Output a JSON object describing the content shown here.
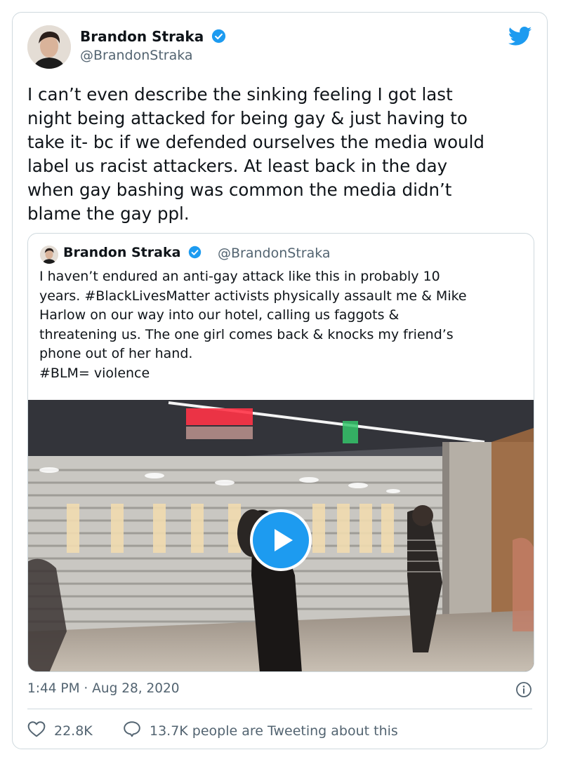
{
  "author": {
    "display_name": "Brandon Straka",
    "handle": "@BrandonStraka",
    "verified": true
  },
  "tweet": {
    "text": "I can’t even describe the sinking feeling I got last\nnight being attacked for being gay & just having to\ntake it- bc if we defended ourselves the media would\nlabel us racist attackers. At least back in the day\nwhen gay bashing was common the media didn’t\nblame the gay ppl.",
    "timestamp": "1:44 PM · Aug 28, 2020"
  },
  "quoted_tweet": {
    "display_name": "Brandon Straka",
    "handle": "@BrandonStraka",
    "verified": true,
    "text": "I haven’t endured an anti-gay attack like this in probably 10\nyears. #BlackLivesMatter activists physically assault me & Mike\nHarlow on our way into our hotel, calling us faggots &\nthreatening us. The one girl comes back & knocks my friend’s\nphone out of her hand.\n#BLM= violence",
    "media_type": "video"
  },
  "engagement": {
    "likes": "22.8K",
    "discussion": "13.7K people are Tweeting about this"
  },
  "icons": {
    "brand": "twitter-bird-icon",
    "verified": "verified-badge-icon",
    "like": "heart-icon",
    "reply": "reply-bubble-icon",
    "info": "info-icon",
    "play": "play-icon"
  },
  "colors": {
    "accent": "#1d9bf0",
    "text": "#0f1419",
    "secondary": "#536471",
    "border": "#cfd9de"
  }
}
